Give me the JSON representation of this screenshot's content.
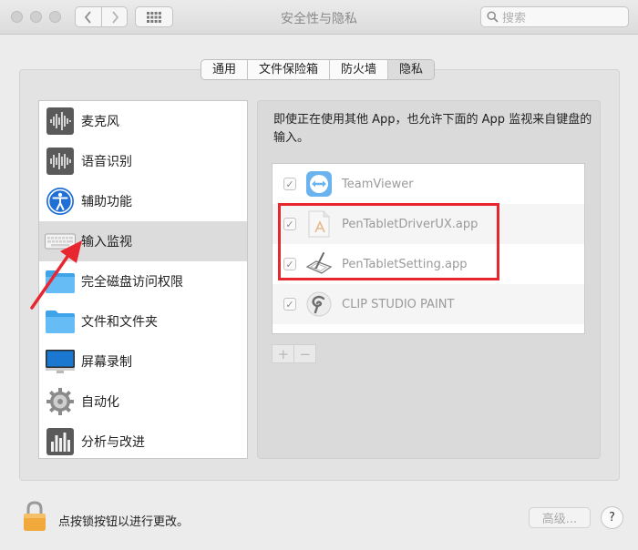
{
  "window": {
    "title": "安全性与隐私",
    "search_placeholder": "搜索"
  },
  "tabs": [
    {
      "label": "通用"
    },
    {
      "label": "文件保险箱"
    },
    {
      "label": "防火墙"
    },
    {
      "label": "隐私",
      "active": true
    }
  ],
  "sidebar": {
    "items": [
      {
        "label": "麦克风",
        "icon": "microphone-waveform-icon"
      },
      {
        "label": "语音识别",
        "icon": "speech-waveform-icon"
      },
      {
        "label": "辅助功能",
        "icon": "accessibility-icon"
      },
      {
        "label": "输入监视",
        "icon": "keyboard-icon",
        "selected": true
      },
      {
        "label": "完全磁盘访问权限",
        "icon": "folder-icon"
      },
      {
        "label": "文件和文件夹",
        "icon": "folder-icon"
      },
      {
        "label": "屏幕录制",
        "icon": "display-icon"
      },
      {
        "label": "自动化",
        "icon": "gear-icon"
      },
      {
        "label": "分析与改进",
        "icon": "bar-chart-icon"
      }
    ]
  },
  "main": {
    "description": "即使正在使用其他 App，也允许下面的 App 监视来自键盘的输入。",
    "apps": [
      {
        "name": "TeamViewer",
        "checked": true,
        "icon": "teamviewer-icon"
      },
      {
        "name": "PenTabletDriverUX.app",
        "checked": true,
        "icon": "app-document-icon"
      },
      {
        "name": "PenTabletSetting.app",
        "checked": true,
        "icon": "pen-tablet-icon"
      },
      {
        "name": "CLIP STUDIO PAINT",
        "checked": true,
        "icon": "clip-studio-icon"
      }
    ],
    "add_label": "+",
    "remove_label": "−"
  },
  "footer": {
    "lock_text": "点按锁按钮以进行更改。",
    "advanced_label": "高级...",
    "help_label": "?"
  },
  "colors": {
    "highlight": "#e8262f",
    "selected_row": "#dcdcdc"
  }
}
